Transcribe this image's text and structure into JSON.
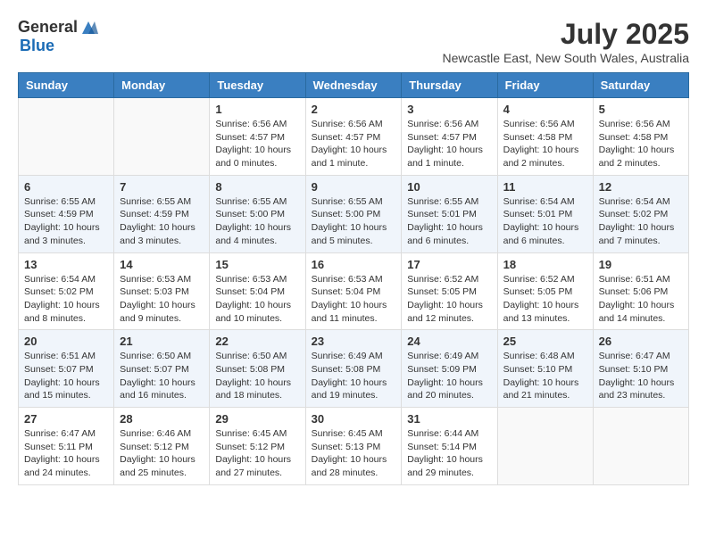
{
  "header": {
    "logo": {
      "general": "General",
      "blue": "Blue"
    },
    "month_year": "July 2025",
    "location": "Newcastle East, New South Wales, Australia"
  },
  "days_of_week": [
    "Sunday",
    "Monday",
    "Tuesday",
    "Wednesday",
    "Thursday",
    "Friday",
    "Saturday"
  ],
  "weeks": [
    [
      {
        "day": "",
        "info": ""
      },
      {
        "day": "",
        "info": ""
      },
      {
        "day": "1",
        "info": "Sunrise: 6:56 AM\nSunset: 4:57 PM\nDaylight: 10 hours\nand 0 minutes."
      },
      {
        "day": "2",
        "info": "Sunrise: 6:56 AM\nSunset: 4:57 PM\nDaylight: 10 hours\nand 1 minute."
      },
      {
        "day": "3",
        "info": "Sunrise: 6:56 AM\nSunset: 4:57 PM\nDaylight: 10 hours\nand 1 minute."
      },
      {
        "day": "4",
        "info": "Sunrise: 6:56 AM\nSunset: 4:58 PM\nDaylight: 10 hours\nand 2 minutes."
      },
      {
        "day": "5",
        "info": "Sunrise: 6:56 AM\nSunset: 4:58 PM\nDaylight: 10 hours\nand 2 minutes."
      }
    ],
    [
      {
        "day": "6",
        "info": "Sunrise: 6:55 AM\nSunset: 4:59 PM\nDaylight: 10 hours\nand 3 minutes."
      },
      {
        "day": "7",
        "info": "Sunrise: 6:55 AM\nSunset: 4:59 PM\nDaylight: 10 hours\nand 3 minutes."
      },
      {
        "day": "8",
        "info": "Sunrise: 6:55 AM\nSunset: 5:00 PM\nDaylight: 10 hours\nand 4 minutes."
      },
      {
        "day": "9",
        "info": "Sunrise: 6:55 AM\nSunset: 5:00 PM\nDaylight: 10 hours\nand 5 minutes."
      },
      {
        "day": "10",
        "info": "Sunrise: 6:55 AM\nSunset: 5:01 PM\nDaylight: 10 hours\nand 6 minutes."
      },
      {
        "day": "11",
        "info": "Sunrise: 6:54 AM\nSunset: 5:01 PM\nDaylight: 10 hours\nand 6 minutes."
      },
      {
        "day": "12",
        "info": "Sunrise: 6:54 AM\nSunset: 5:02 PM\nDaylight: 10 hours\nand 7 minutes."
      }
    ],
    [
      {
        "day": "13",
        "info": "Sunrise: 6:54 AM\nSunset: 5:02 PM\nDaylight: 10 hours\nand 8 minutes."
      },
      {
        "day": "14",
        "info": "Sunrise: 6:53 AM\nSunset: 5:03 PM\nDaylight: 10 hours\nand 9 minutes."
      },
      {
        "day": "15",
        "info": "Sunrise: 6:53 AM\nSunset: 5:04 PM\nDaylight: 10 hours\nand 10 minutes."
      },
      {
        "day": "16",
        "info": "Sunrise: 6:53 AM\nSunset: 5:04 PM\nDaylight: 10 hours\nand 11 minutes."
      },
      {
        "day": "17",
        "info": "Sunrise: 6:52 AM\nSunset: 5:05 PM\nDaylight: 10 hours\nand 12 minutes."
      },
      {
        "day": "18",
        "info": "Sunrise: 6:52 AM\nSunset: 5:05 PM\nDaylight: 10 hours\nand 13 minutes."
      },
      {
        "day": "19",
        "info": "Sunrise: 6:51 AM\nSunset: 5:06 PM\nDaylight: 10 hours\nand 14 minutes."
      }
    ],
    [
      {
        "day": "20",
        "info": "Sunrise: 6:51 AM\nSunset: 5:07 PM\nDaylight: 10 hours\nand 15 minutes."
      },
      {
        "day": "21",
        "info": "Sunrise: 6:50 AM\nSunset: 5:07 PM\nDaylight: 10 hours\nand 16 minutes."
      },
      {
        "day": "22",
        "info": "Sunrise: 6:50 AM\nSunset: 5:08 PM\nDaylight: 10 hours\nand 18 minutes."
      },
      {
        "day": "23",
        "info": "Sunrise: 6:49 AM\nSunset: 5:08 PM\nDaylight: 10 hours\nand 19 minutes."
      },
      {
        "day": "24",
        "info": "Sunrise: 6:49 AM\nSunset: 5:09 PM\nDaylight: 10 hours\nand 20 minutes."
      },
      {
        "day": "25",
        "info": "Sunrise: 6:48 AM\nSunset: 5:10 PM\nDaylight: 10 hours\nand 21 minutes."
      },
      {
        "day": "26",
        "info": "Sunrise: 6:47 AM\nSunset: 5:10 PM\nDaylight: 10 hours\nand 23 minutes."
      }
    ],
    [
      {
        "day": "27",
        "info": "Sunrise: 6:47 AM\nSunset: 5:11 PM\nDaylight: 10 hours\nand 24 minutes."
      },
      {
        "day": "28",
        "info": "Sunrise: 6:46 AM\nSunset: 5:12 PM\nDaylight: 10 hours\nand 25 minutes."
      },
      {
        "day": "29",
        "info": "Sunrise: 6:45 AM\nSunset: 5:12 PM\nDaylight: 10 hours\nand 27 minutes."
      },
      {
        "day": "30",
        "info": "Sunrise: 6:45 AM\nSunset: 5:13 PM\nDaylight: 10 hours\nand 28 minutes."
      },
      {
        "day": "31",
        "info": "Sunrise: 6:44 AM\nSunset: 5:14 PM\nDaylight: 10 hours\nand 29 minutes."
      },
      {
        "day": "",
        "info": ""
      },
      {
        "day": "",
        "info": ""
      }
    ]
  ]
}
